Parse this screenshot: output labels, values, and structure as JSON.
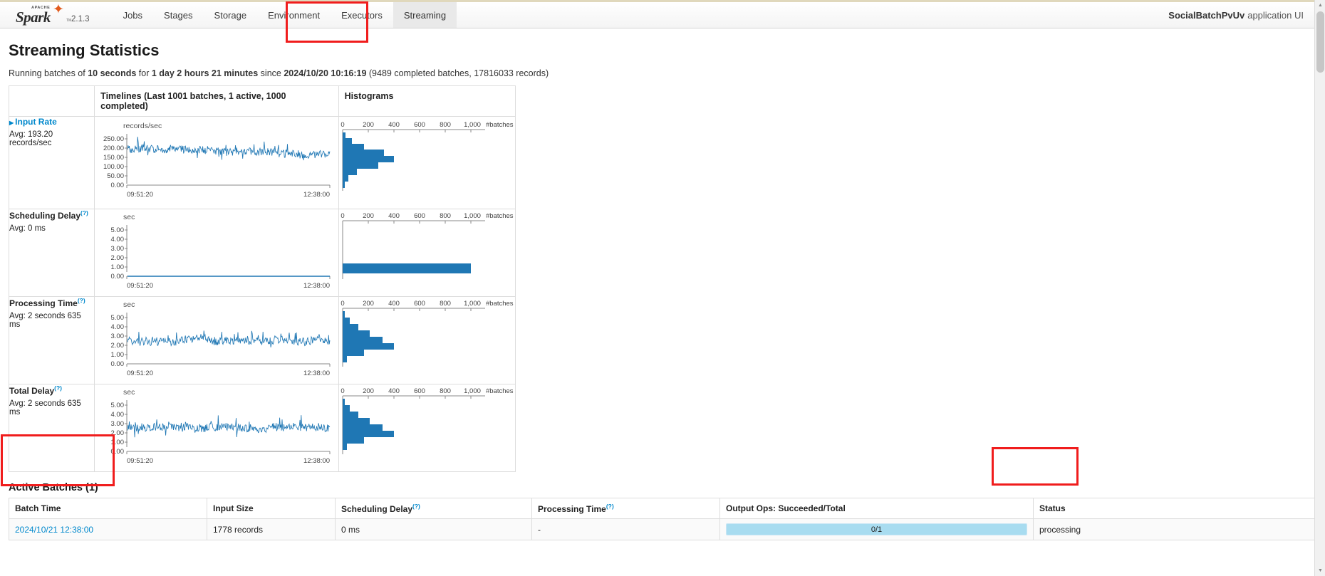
{
  "navbar": {
    "brand": {
      "apache": "APACHE",
      "name": "Spark",
      "version": "2.1.3"
    },
    "items": [
      {
        "label": "Jobs",
        "active": false
      },
      {
        "label": "Stages",
        "active": false
      },
      {
        "label": "Storage",
        "active": false
      },
      {
        "label": "Environment",
        "active": false
      },
      {
        "label": "Executors",
        "active": false
      },
      {
        "label": "Streaming",
        "active": true
      }
    ],
    "app_name": "SocialBatchPvUv",
    "app_suffix": "application UI"
  },
  "page": {
    "title": "Streaming Statistics",
    "subtitle_parts": {
      "prefix": "Running batches of ",
      "batch_interval": "10 seconds",
      "mid1": " for ",
      "uptime": "1 day 2 hours 21 minutes",
      "mid2": " since ",
      "start_time": "2024/10/20 10:16:19",
      "suffix": " (9489 completed batches, 17816033 records)"
    },
    "subtitle_full": "Running batches of 10 seconds for 1 day 2 hours 21 minutes since 2024/10/20 10:16:19 (9489 completed batches, 17816033 records)"
  },
  "stats_table": {
    "headers": {
      "blank": "",
      "timelines": "Timelines (Last 1001 batches, 1 active, 1000 completed)",
      "histograms": "Histograms"
    },
    "rows": [
      {
        "name": "Input Rate",
        "is_link": true,
        "has_arrow": true,
        "has_help": false,
        "avg": "Avg: 193.20 records/sec",
        "unit": "records/sec",
        "y_ticks": [
          "250.00",
          "200.00",
          "150.00",
          "100.00",
          "50.00",
          "0.00"
        ],
        "x_start": "09:51:20",
        "x_end": "12:38:00"
      },
      {
        "name": "Scheduling Delay",
        "is_link": false,
        "has_arrow": false,
        "has_help": true,
        "avg": "Avg: 0 ms",
        "unit": "sec",
        "y_ticks": [
          "5.00",
          "4.00",
          "3.00",
          "2.00",
          "1.00",
          "0.00"
        ],
        "x_start": "09:51:20",
        "x_end": "12:38:00"
      },
      {
        "name": "Processing Time",
        "is_link": false,
        "has_arrow": false,
        "has_help": true,
        "avg": "Avg: 2 seconds 635 ms",
        "unit": "sec",
        "y_ticks": [
          "5.00",
          "4.00",
          "3.00",
          "2.00",
          "1.00",
          "0.00"
        ],
        "x_start": "09:51:20",
        "x_end": "12:38:00"
      },
      {
        "name": "Total Delay",
        "is_link": false,
        "has_arrow": false,
        "has_help": true,
        "avg": "Avg: 2 seconds 635 ms",
        "unit": "sec",
        "y_ticks": [
          "5.00",
          "4.00",
          "3.00",
          "2.00",
          "1.00",
          "0.00"
        ],
        "x_start": "09:51:20",
        "x_end": "12:38:00"
      }
    ],
    "histogram_axis": {
      "ticks": [
        "0",
        "200",
        "400",
        "600",
        "800",
        "1,000"
      ],
      "unit_label": "#batches"
    }
  },
  "chart_data": [
    {
      "type": "line",
      "title": "Input Rate",
      "ylabel": "records/sec",
      "xlabel": "",
      "ylim": [
        0,
        280
      ],
      "xlim_labels": [
        "09:51:20",
        "12:38:00"
      ],
      "y_ticks": [
        0,
        50,
        100,
        150,
        200,
        250
      ],
      "avg": 193.2,
      "series_color": "#1f77b4",
      "n_points": 1001,
      "baseline": 193,
      "amplitude": 42,
      "trend": -30
    },
    {
      "type": "bar",
      "title": "Input Rate Histogram",
      "orientation": "horizontal",
      "xlabel": "#batches",
      "xlim": [
        0,
        1000
      ],
      "x_ticks": [
        0,
        200,
        400,
        600,
        800,
        1000
      ],
      "bins": [
        20,
        65,
        150,
        290,
        360,
        250,
        100,
        40,
        15
      ],
      "series_color": "#1f77b4"
    },
    {
      "type": "line",
      "title": "Scheduling Delay",
      "ylabel": "sec",
      "ylim": [
        0,
        5.6
      ],
      "xlim_labels": [
        "09:51:20",
        "12:38:00"
      ],
      "y_ticks": [
        0,
        1,
        2,
        3,
        4,
        5
      ],
      "avg": 0,
      "series_color": "#1f77b4",
      "n_points": 1001,
      "baseline": 0,
      "amplitude": 0,
      "trend": 0
    },
    {
      "type": "bar",
      "title": "Scheduling Delay Histogram",
      "orientation": "horizontal",
      "xlabel": "#batches",
      "xlim": [
        0,
        1000
      ],
      "x_ticks": [
        0,
        200,
        400,
        600,
        800,
        1000
      ],
      "bins": [
        1000
      ],
      "series_color": "#1f77b4"
    },
    {
      "type": "line",
      "title": "Processing Time",
      "ylabel": "sec",
      "ylim": [
        0,
        5.6
      ],
      "xlim_labels": [
        "09:51:20",
        "12:38:00"
      ],
      "y_ticks": [
        0,
        1,
        2,
        3,
        4,
        5
      ],
      "avg": 2.635,
      "series_color": "#1f77b4",
      "n_points": 1001,
      "baseline": 2.5,
      "amplitude": 0.9,
      "trend": 0
    },
    {
      "type": "bar",
      "title": "Processing Time Histogram",
      "orientation": "horizontal",
      "xlabel": "#batches",
      "xlim": [
        0,
        1000
      ],
      "x_ticks": [
        0,
        200,
        400,
        600,
        800,
        1000
      ],
      "bins": [
        30,
        90,
        180,
        300,
        250,
        100,
        40,
        10
      ],
      "series_color": "#1f77b4"
    },
    {
      "type": "line",
      "title": "Total Delay",
      "ylabel": "sec",
      "ylim": [
        0,
        5.6
      ],
      "xlim_labels": [
        "09:51:20",
        "12:38:00"
      ],
      "y_ticks": [
        0,
        1,
        2,
        3,
        4,
        5
      ],
      "avg": 2.635,
      "series_color": "#1f77b4",
      "n_points": 1001,
      "baseline": 2.5,
      "amplitude": 0.9,
      "trend": 0
    },
    {
      "type": "bar",
      "title": "Total Delay Histogram",
      "orientation": "horizontal",
      "xlabel": "#batches",
      "xlim": [
        0,
        1000
      ],
      "x_ticks": [
        0,
        200,
        400,
        600,
        800,
        1000
      ],
      "bins": [
        30,
        90,
        180,
        300,
        250,
        100,
        40,
        10
      ],
      "series_color": "#1f77b4"
    }
  ],
  "active_batches": {
    "title": "Active Batches (1)",
    "columns": [
      "Batch Time",
      "Input Size",
      "Scheduling Delay",
      "Processing Time",
      "Output Ops: Succeeded/Total",
      "Status"
    ],
    "columns_help": [
      false,
      false,
      true,
      true,
      false,
      false
    ],
    "rows": [
      {
        "batch_time": "2024/10/21 12:38:00",
        "input_size": "1778 records",
        "scheduling_delay": "0 ms",
        "processing_time": "-",
        "output_ops": "0/1",
        "status": "processing"
      }
    ]
  },
  "colors": {
    "accent_blue": "#1f77b4",
    "link_blue": "#0088cc",
    "annotation_red": "#f01d1d",
    "progress_fill": "#a8dcf0"
  },
  "annotations": [
    {
      "name": "streaming-tab-highlight"
    },
    {
      "name": "active-batches-highlight"
    },
    {
      "name": "status-column-highlight"
    }
  ]
}
